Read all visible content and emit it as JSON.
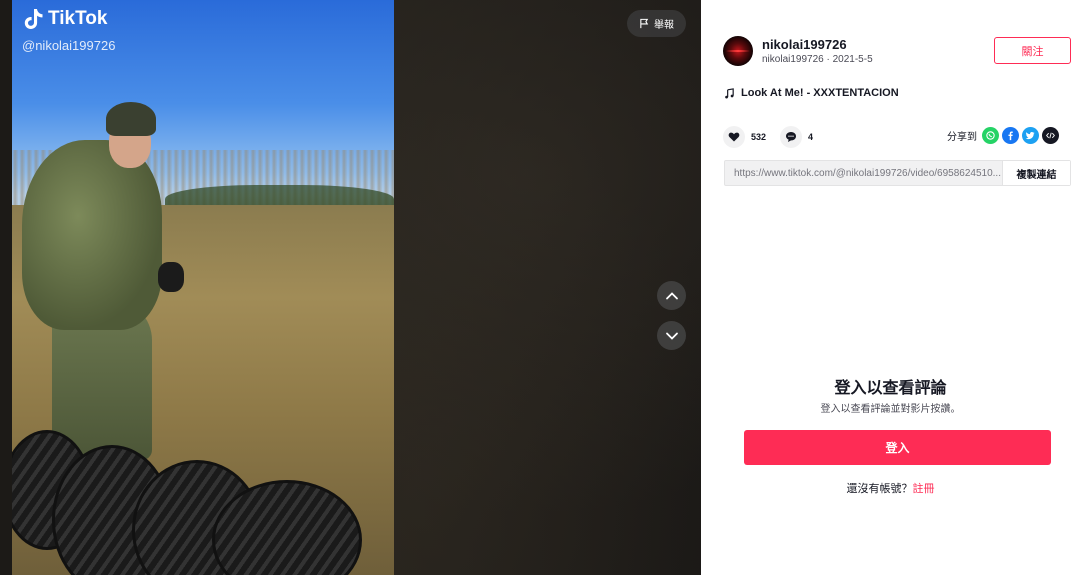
{
  "video": {
    "brand": "TikTok",
    "handle": "@nikolai199726",
    "report_label": "舉報"
  },
  "author": {
    "username": "nikolai199726",
    "subline": "nikolai199726 · 2021-5-5",
    "follow_label": "關注"
  },
  "music": {
    "title": "Look At Me! - XXXTENTACION"
  },
  "stats": {
    "likes": "532",
    "comments": "4"
  },
  "share": {
    "label": "分享到",
    "targets": [
      "whatsapp-icon",
      "facebook-icon",
      "twitter-icon",
      "embed-icon"
    ]
  },
  "link": {
    "url": "https://www.tiktok.com/@nikolai199726/video/6958624510...",
    "copy_label": "複製連結"
  },
  "login": {
    "title": "登入以查看評論",
    "subtitle": "登入以查看評論並對影片按讚。",
    "button_label": "登入",
    "prompt": "還沒有帳號？",
    "signup_label": "註冊"
  },
  "colors": {
    "accent": "#fe2c55",
    "text": "#161823",
    "whatsapp": "#25d366",
    "facebook": "#1877f2",
    "twitter": "#1da1f2",
    "embed": "#161823"
  }
}
